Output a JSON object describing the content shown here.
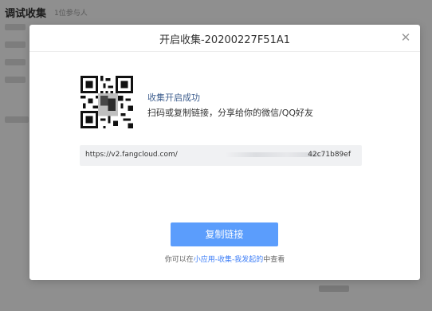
{
  "background": {
    "title": "调试收集",
    "subtitle": "1位参与人"
  },
  "modal": {
    "title": "开启收集-20200227F51A1",
    "close_icon": "close-icon",
    "success_title": "收集开启成功",
    "success_desc": "扫码或复制链接，分享给你的微信/QQ好友",
    "link_prefix": "https://v2.fangcloud.com/",
    "link_suffix": "42c71b89ef",
    "copy_button": "复制链接",
    "hint_before": "你可以在",
    "hint_link": "小应用-收集-我发起的",
    "hint_after": "中查看"
  },
  "colors": {
    "primary_button": "#5b9dfc",
    "link": "#3d7ef7",
    "success_title": "#3f5f8f"
  }
}
